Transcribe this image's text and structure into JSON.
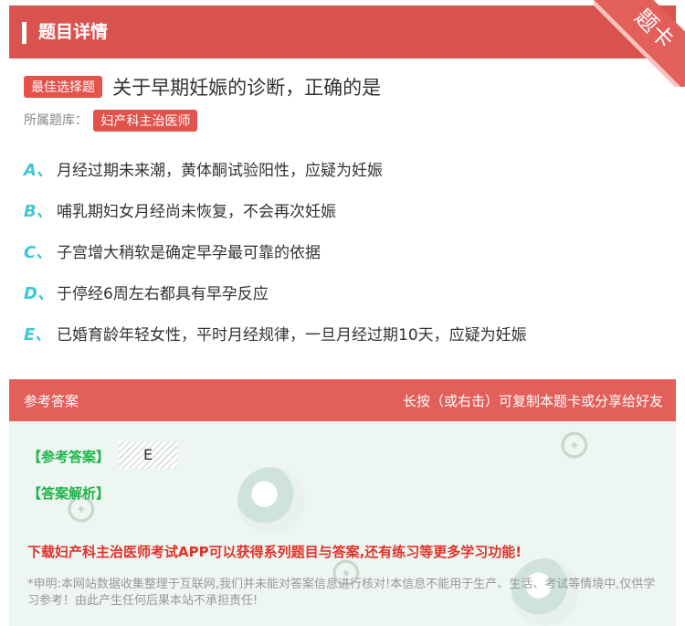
{
  "header": {
    "title": "题目详情",
    "corner_label": "题卡"
  },
  "question": {
    "type_tag": "最佳选择题",
    "title": "关于早期妊娠的诊断，正确的是",
    "library_label": "所属题库：",
    "library_tag": "妇产科主治医师"
  },
  "options": [
    {
      "letter": "A、",
      "text": "月经过期未来潮，黄体酮试验阳性，应疑为妊娠"
    },
    {
      "letter": "B、",
      "text": "哺乳期妇女月经尚未恢复，不会再次妊娠"
    },
    {
      "letter": "C、",
      "text": "子宫增大稍软是确定早孕最可靠的依据"
    },
    {
      "letter": "D、",
      "text": "于停经6周左右都具有早孕反应"
    },
    {
      "letter": "E、",
      "text": "已婚育龄年轻女性，平时月经规律，一旦月经过期10天，应疑为妊娠"
    }
  ],
  "answer_bar": {
    "left": "参考答案",
    "right": "长按（或右击）可复制本题卡或分享给好友"
  },
  "answer": {
    "ref_label": "【参考答案】",
    "ref_value": "E",
    "analysis_label": "【答案解析】",
    "download": "下载妇产科主治医师考试APP可以获得系列题目与答案,还有练习等更多学习功能!",
    "notice": "*申明:本网站数据收集整理于互联网,我们并未能对答案信息进行核对!本信息不能用于生产、生活、考试等情境中,仅供学习参考！由此产生任何后果本站不承担责任!"
  },
  "colors": {
    "accent": "#d9534f",
    "tag": "#e4524c",
    "option_letter": "#3ec8d6",
    "answer_green": "#1fb44a",
    "download_red": "#e0322b"
  }
}
